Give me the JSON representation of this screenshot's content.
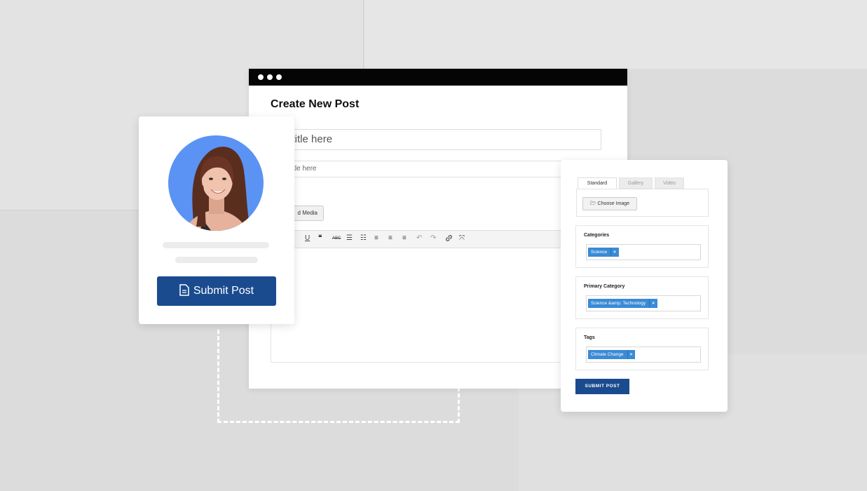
{
  "editor": {
    "page_title": "Create New Post",
    "title_placeholder": "er title here",
    "subtitle_placeholder": "subtitle here",
    "content_label": "ntent",
    "add_media_label": "d Media",
    "toolbar_icons": [
      "underline-icon",
      "quote-icon",
      "strikethrough-icon",
      "bullet-list-icon",
      "numbered-list-icon",
      "align-left-icon",
      "align-center-icon",
      "align-right-icon",
      "undo-icon",
      "redo-icon",
      "link-icon",
      "fullscreen-icon"
    ]
  },
  "profile_card": {
    "submit_label": "Submit Post"
  },
  "side_panel": {
    "tabs": [
      "Standard",
      "Gallery",
      "Video"
    ],
    "active_tab": "Standard",
    "choose_image_label": "Choose Image",
    "categories": {
      "label": "Categories",
      "chip": "Science",
      "chip_remove": "×"
    },
    "primary_category": {
      "label": "Primary Category",
      "chip": "Science &amp; Technology",
      "chip_remove": "×"
    },
    "tags": {
      "label": "Tags",
      "chip": "Climate Change",
      "chip_remove": "×"
    },
    "submit_label": "SUBMIT POST"
  },
  "colors": {
    "accent": "#1a4b8f",
    "chip": "#3a8ad6",
    "avatar_bg": "#5b93f5",
    "background": "#dcdcdc"
  }
}
